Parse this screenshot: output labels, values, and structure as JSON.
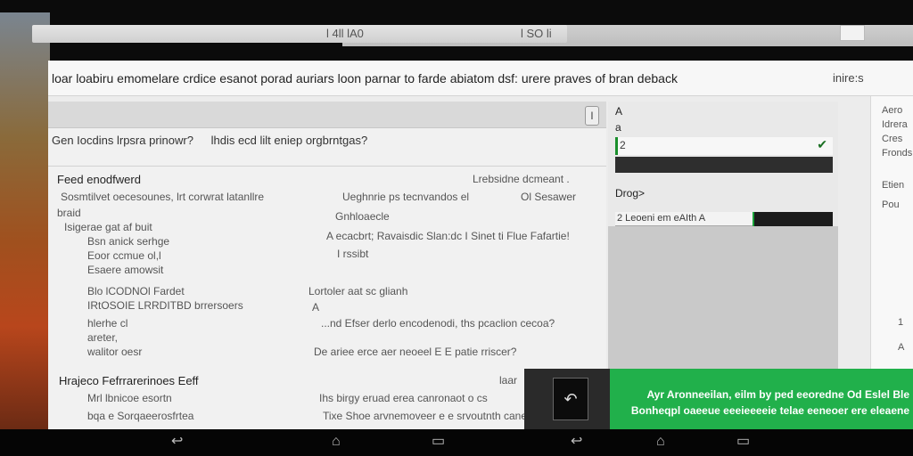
{
  "topbar": {
    "left_label": "l 4ll lA0",
    "center_label": "l SO li"
  },
  "window": {
    "title": "loar loabiru emomelare crdice esanot porad auriars loon parnar to farde abiatom dsf: urere   praves of bran deback",
    "title_right": "inire:s"
  },
  "content": {
    "search_toggle": "l",
    "question_left": "Gen Iocdins lrpsra prinowr?",
    "question_right": "lhdis ecd lilt eniep orgbrntgas?",
    "section1": {
      "header": "Feed enodfwerd",
      "header_right": "Lrebsidne dcmeant .",
      "lines_left": [
        "Sosmtilvet oecesounes,  lrt corwrat latanllre",
        "braid",
        "Isigerae gat af buit",
        "Bsn anick serhge",
        "Eoor ccmue ol,l",
        "Esaere amowsit"
      ],
      "lines_right": [
        "Ueghnrie ps tecnvandos el",
        "Ol Sesawer",
        "Gnhloaecle",
        "A ecacbrt; Ravaisdic Slan:dc I Sinet ti Flue Fafartie!",
        "I rssibt"
      ]
    },
    "section2": {
      "lines_left": [
        "Blo lCODNOl Fardet",
        "IRtOSOIE LRRDITBD brrersoers",
        "hlerhe cl",
        "areter,",
        "walitor oesr"
      ],
      "lines_right": [
        "Lortoler aat sc glianh",
        "A",
        "...nd Efser derlo encodenodi,  ths pcaclion cecoa?",
        "De ariee erce aer neoeel E E patie rriscer?"
      ]
    },
    "section3": {
      "header": "Hrajeco Fefrrarerinoes Eeff",
      "header_right": "laar",
      "lines_left": [
        "Mrl lbnicoe esortn",
        "bqa e Sorqaeerosfrtea"
      ],
      "lines_right": [
        "Ihs birgy eruad erea canronaot o cs",
        "Tixe Shoe arvnemoveer e e srvoutnth cane"
      ]
    }
  },
  "side": {
    "item1": "A",
    "item2": "a",
    "select_value": "2",
    "label": "Drog>",
    "progress_label": "2 Leoeni em eAIth A",
    "progress": 0.4
  },
  "farright": {
    "items": [
      "Aero",
      "Idrera",
      "Cres",
      "Fronds",
      "Etien",
      "Pou",
      "1",
      "A"
    ]
  },
  "banner": {
    "line1": "Ayr Aronneeilan, eilm by ped eeoredne Od Eslel Ble",
    "line2": "Bonheqpl oaeeue eeeieeeeie telae eeneoer ere eleaene"
  },
  "colors": {
    "accent": "#21b04b",
    "progress_fill": "#1b1b1b"
  }
}
